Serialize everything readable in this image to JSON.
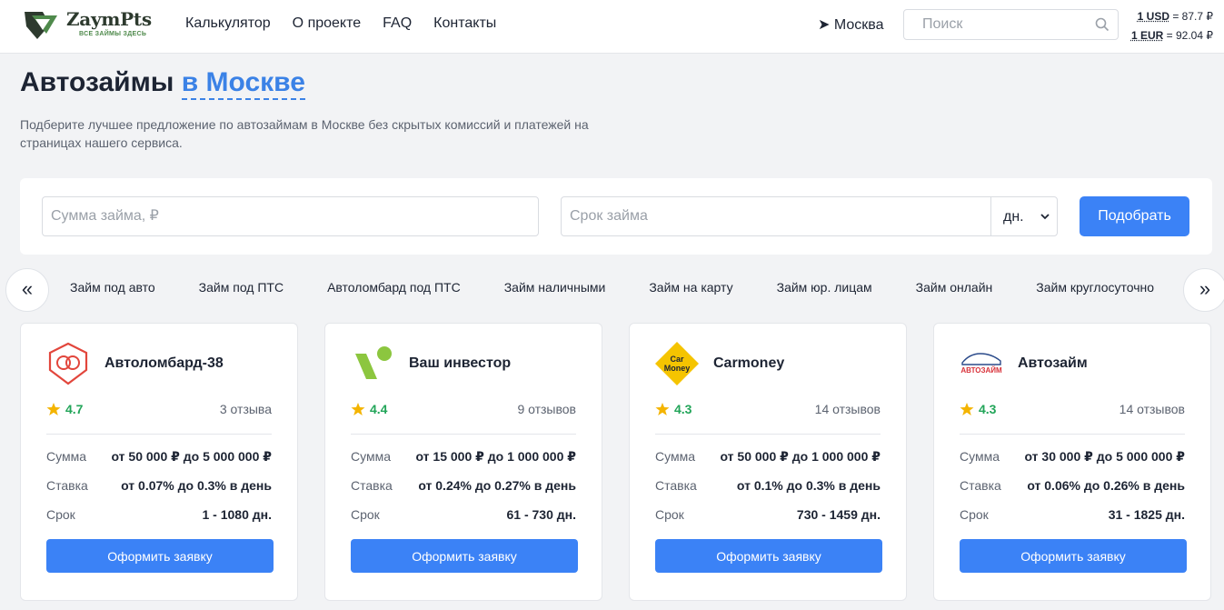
{
  "header": {
    "logo_text": "ZaymPts",
    "logo_sub": "ВСЕ ЗАЙМЫ ЗДЕСЬ",
    "nav": [
      "Калькулятор",
      "О проекте",
      "FAQ",
      "Контакты"
    ],
    "city": "Москва",
    "search_placeholder": "Поиск",
    "rates": [
      {
        "label": "1 USD",
        "value": " = 87.7 ₽"
      },
      {
        "label": "1 EUR",
        "value": " = 92.04 ₽"
      }
    ]
  },
  "hero": {
    "title_main": "Автозаймы",
    "title_city": "в Москве",
    "subtitle": "Подберите лучшее предложение по автозаймам в Москве без скрытых комиссий и платежей на страницах нашего сервиса."
  },
  "filter": {
    "amount_placeholder": "Сумма займа, ₽",
    "term_placeholder": "Срок займа",
    "unit_value": "дн.",
    "submit_label": "Подобрать"
  },
  "categories": {
    "prev": "«",
    "next": "»",
    "items": [
      "Займ под авто",
      "Займ под ПТС",
      "Автоломбард под ПТС",
      "Займ наличными",
      "Займ на карту",
      "Займ юр. лицам",
      "Займ онлайн",
      "Займ круглосуточно"
    ]
  },
  "offer_labels": {
    "sum": "Сумма",
    "rate": "Ставка",
    "term": "Срок",
    "apply": "Оформить заявку"
  },
  "offers": [
    {
      "name": "Автоломбард-38",
      "logo": "avtolombard-38-logo",
      "rating": "4.7",
      "reviews": "3 отзыва",
      "sum": "от 50 000 ₽ до 5 000 000 ₽",
      "rate": "от 0.07% до 0.3% в день",
      "term": "1 - 1080 дн."
    },
    {
      "name": "Ваш инвестор",
      "logo": "vash-investor-logo",
      "rating": "4.4",
      "reviews": "9 отзывов",
      "sum": "от 15 000 ₽ до 1 000 000 ₽",
      "rate": "от 0.24% до 0.27% в день",
      "term": "61 - 730 дн."
    },
    {
      "name": "Carmoney",
      "logo": "carmoney-logo",
      "logo_text": [
        "Car",
        "Money"
      ],
      "rating": "4.3",
      "reviews": "14 отзывов",
      "sum": "от 50 000 ₽ до 1 000 000 ₽",
      "rate": "от 0.1% до 0.3% в день",
      "term": "730 - 1459 дн."
    },
    {
      "name": "Автозайм",
      "logo": "avtozaym-logo",
      "logo_text": [
        "АВТОЗАЙМ"
      ],
      "rating": "4.3",
      "reviews": "14 отзывов",
      "sum": "от 30 000 ₽ до 5 000 000 ₽",
      "rate": "от 0.06% до 0.26% в день",
      "term": "31 - 1825 дн."
    }
  ],
  "colors": {
    "accent": "#3b82f6",
    "rating_green": "#22a559",
    "star": "#f4b400"
  }
}
